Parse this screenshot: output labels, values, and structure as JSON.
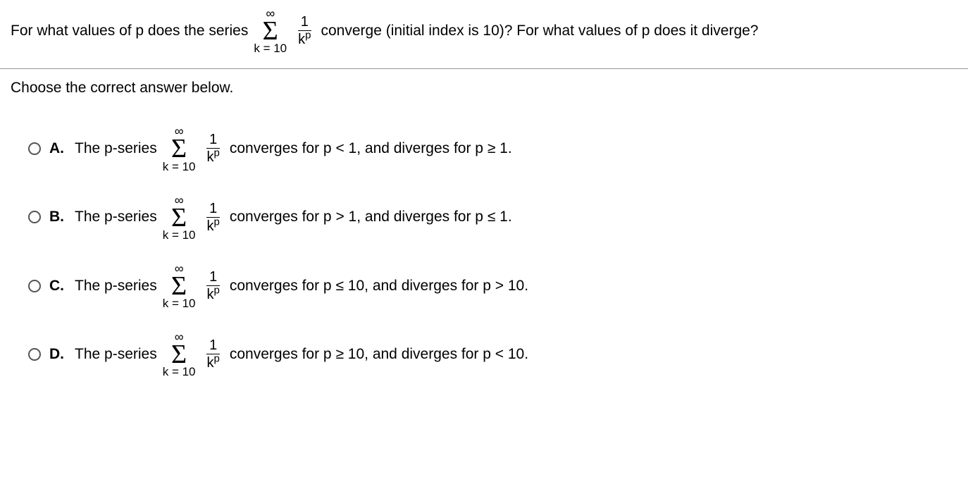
{
  "question": {
    "part1": "For what values of p does the series",
    "part2": "converge (initial index is 10)? For what values of p does it diverge?"
  },
  "sigma": {
    "top": "∞",
    "symbol": "Σ",
    "bottom": "k = 10",
    "frac_num": "1",
    "frac_den_base": "k",
    "frac_den_exp": "p"
  },
  "instruction": "Choose the correct answer below.",
  "choices": [
    {
      "letter": "A.",
      "prefix": "The p-series",
      "suffix": "converges for p < 1, and diverges for p ≥ 1."
    },
    {
      "letter": "B.",
      "prefix": "The p-series",
      "suffix": "converges for p > 1, and diverges for p ≤ 1."
    },
    {
      "letter": "C.",
      "prefix": "The p-series",
      "suffix": "converges for p ≤ 10, and diverges for p > 10."
    },
    {
      "letter": "D.",
      "prefix": "The p-series",
      "suffix": "converges for p ≥ 10, and diverges for p < 10."
    }
  ]
}
